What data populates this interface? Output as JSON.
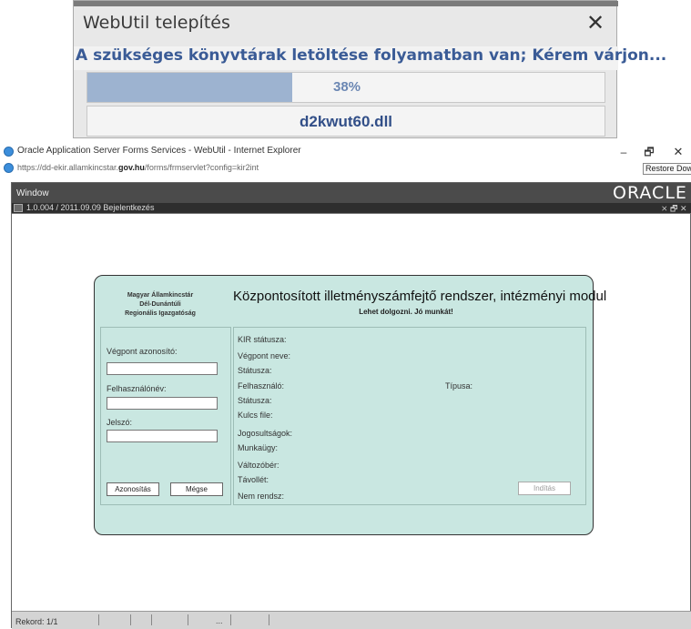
{
  "webutil": {
    "title": "WebUtil telepítés",
    "close": "✕",
    "message": "A szükséges könyvtárak letöltése folyamatban van; Kérem várjon...",
    "progress_fraction": 0.38,
    "progress_text": "38%",
    "file": "d2kwut60.dll"
  },
  "ie": {
    "title": "Oracle Application Server Forms Services - WebUtil - Internet Explorer",
    "url_prefix": "https://dd-ekir.allamkincstar.",
    "url_bold": "gov.hu",
    "url_suffix": "/forms/frmservlet?config=kir2int",
    "min": "–",
    "restore": "🗗",
    "close": "✕",
    "tooltip": "Restore Down"
  },
  "app": {
    "menu_window": "Window",
    "oracle_logo": "ORACLE",
    "form_title": "1.0.004 / 2011.09.09 Bejelentkezés",
    "form_controls": "⨯ 🗗 ✕"
  },
  "panel": {
    "org_line1": "Magyar Államkincstár",
    "org_line2": "Dél-Dunántúli",
    "org_line3": "Regionális Igazgatóság",
    "title": "Központosított illetményszámfejtő rendszer, intézményi modul",
    "subtitle": "Lehet dolgozni. Jó munkát!",
    "left": {
      "vegpont_label": "Végpont azonosító:",
      "felhasznalo_label": "Felhasználónév:",
      "jelszo_label": "Jelszó:",
      "auth_button": "Azonosítás",
      "cancel_button": "Mégse"
    },
    "right": {
      "kir_status": "KIR státusza:",
      "vegpont_neve": "Végpont neve:",
      "statusza1": "Státusza:",
      "felhasznalo": "Felhasználó:",
      "tipusa": "Típusa:",
      "statusza2": "Státusza:",
      "kulcs_file": "Kulcs file:",
      "jogosultsagok": "Jogosultságok:",
      "munkaugy": "Munkaügy:",
      "valtozober": "Változóbér:",
      "tavollet": "Távollét:",
      "nem_rendsz": "Nem rendsz:",
      "start_button": "Indítás"
    }
  },
  "status": {
    "record": "Rekord: 1/1",
    "dots": "..."
  }
}
